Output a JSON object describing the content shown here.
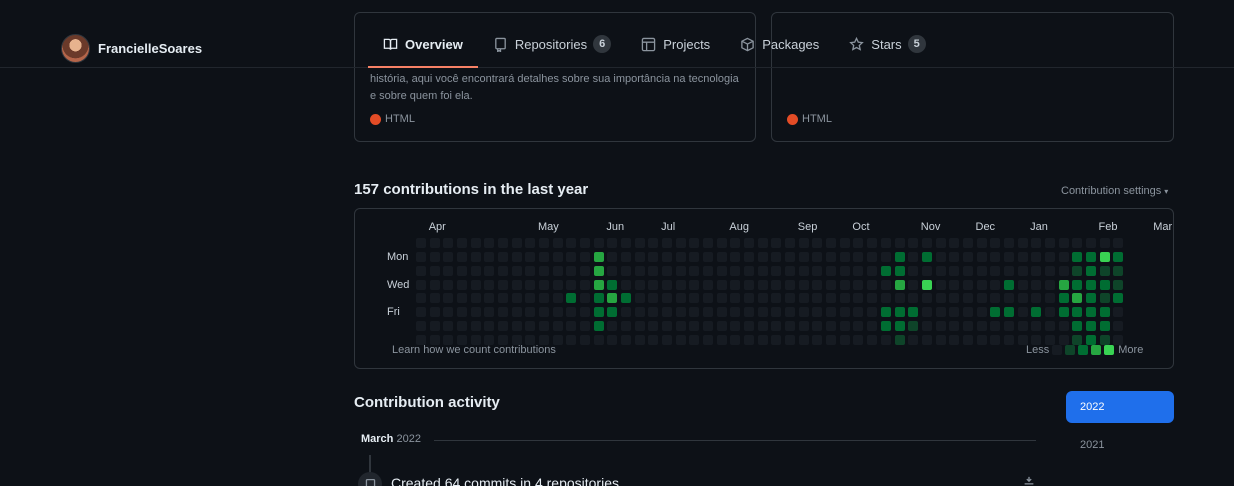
{
  "user": {
    "username": "FrancielleSoares"
  },
  "tabs": [
    {
      "label": "Overview",
      "icon": "book-icon"
    },
    {
      "label": "Repositories",
      "icon": "repo-icon",
      "count": "6"
    },
    {
      "label": "Projects",
      "icon": "table-icon"
    },
    {
      "label": "Packages",
      "icon": "package-icon"
    },
    {
      "label": "Stars",
      "icon": "star-icon",
      "count": "5"
    }
  ],
  "repos": [
    {
      "description": "história, aqui você encontrará detalhes sobre sua importância na tecnologia e sobre quem foi ela.",
      "language": "HTML",
      "language_color": "#e34c26"
    },
    {
      "description": "",
      "language": "HTML",
      "language_color": "#e34c26"
    }
  ],
  "contributions": {
    "title": "157 contributions in the last year",
    "settings": "Contribution settings",
    "months": [
      "Apr",
      "May",
      "Jun",
      "Jul",
      "Aug",
      "Sep",
      "Oct",
      "Nov",
      "Dec",
      "Jan",
      "Feb",
      "Mar"
    ],
    "days": [
      "Mon",
      "Wed",
      "Fri"
    ],
    "learn": "Learn how we count contributions",
    "less": "Less",
    "more": "More",
    "colors": [
      "#161b22",
      "#0e4429",
      "#006d32",
      "#26a641",
      "#39d353"
    ],
    "levels": [
      "0000000000000000000000000000000000000000000000000000",
      "0000000000000300000000000000000000020200000000002242",
      "0000000000000300000000000000000000220000000000001211",
      "0000000000000320000000000000000000030400000200032221",
      "0000000000020232000000000000000000000000000000023212",
      "0000000000000220000000000000000000222000002202022220",
      "0000000000000200000000000000000000221000000000002220",
      "0000000000000000000000000000000000010000000000001210"
    ]
  },
  "activity": {
    "title": "Contribution activity",
    "years": [
      "2022",
      "2021"
    ],
    "month_label": "March",
    "month_year": "2022",
    "item": "Created 64 commits in 4 repositories"
  }
}
